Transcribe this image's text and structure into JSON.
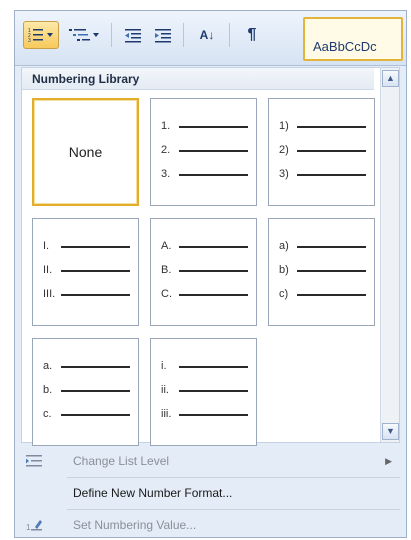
{
  "ribbon": {
    "style_preview": "AaBbCcDc",
    "pilcrow": "¶",
    "sort_glyph": "A↓"
  },
  "gallery": {
    "title": "Numbering Library",
    "tiles": [
      {
        "type": "none",
        "label": "None",
        "selected": true
      },
      {
        "type": "list",
        "markers": [
          "1.",
          "2.",
          "3."
        ]
      },
      {
        "type": "list",
        "markers": [
          "1)",
          "2)",
          "3)"
        ]
      },
      {
        "type": "list",
        "markers": [
          "I.",
          "II.",
          "III."
        ]
      },
      {
        "type": "list",
        "markers": [
          "A.",
          "B.",
          "C."
        ]
      },
      {
        "type": "list",
        "markers": [
          "a)",
          "b)",
          "c)"
        ]
      },
      {
        "type": "list",
        "markers": [
          "a.",
          "b.",
          "c."
        ]
      },
      {
        "type": "list",
        "markers": [
          "i.",
          "ii.",
          "iii."
        ]
      }
    ]
  },
  "menu": {
    "change_list_level": "Change List Level",
    "define_new_number_format": "Define New Number Format...",
    "set_numbering_value": "Set Numbering Value..."
  }
}
